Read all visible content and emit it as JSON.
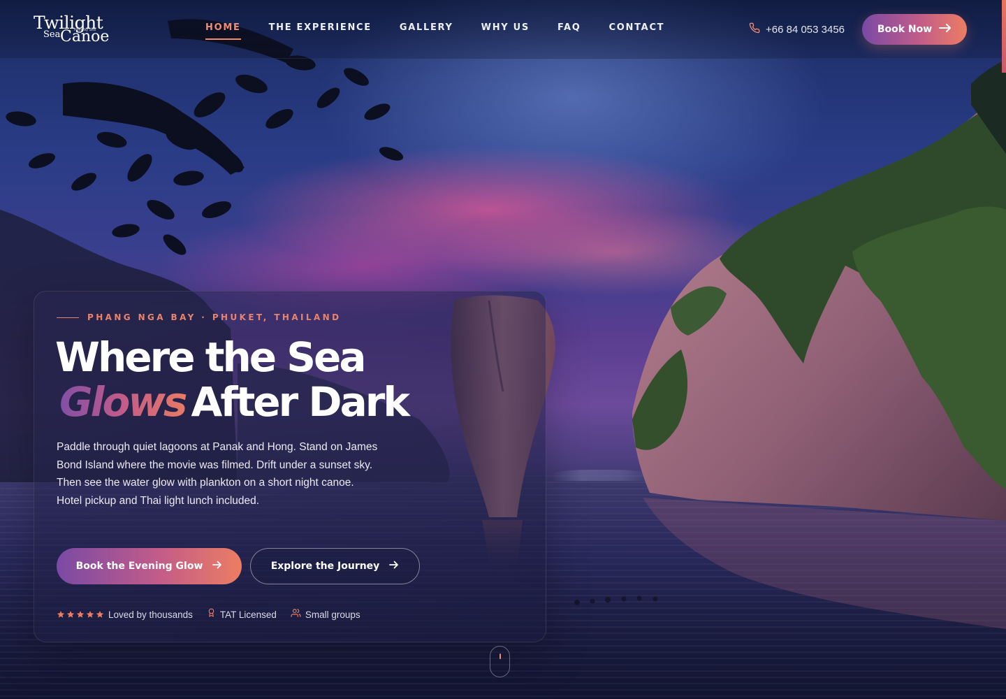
{
  "brand": {
    "line1": "Twilight",
    "line2": "Sea",
    "line3": "Canoe",
    "badge": "Hong by Sea"
  },
  "nav": {
    "items": [
      {
        "label": "HOME",
        "active": true
      },
      {
        "label": "THE EXPERIENCE",
        "active": false
      },
      {
        "label": "GALLERY",
        "active": false
      },
      {
        "label": "WHY US",
        "active": false
      },
      {
        "label": "FAQ",
        "active": false
      },
      {
        "label": "CONTACT",
        "active": false
      }
    ],
    "phone": "+66 84 053 3456",
    "cta_label": "Book Now"
  },
  "hero": {
    "eyebrow": "PHANG NGA BAY · PHUKET, THAILAND",
    "headline_line1": "Where the Sea",
    "headline_highlight": "Glows",
    "headline_line2_rest": "After Dark",
    "description": "Paddle through quiet lagoons at Panak and Hong. Stand on James Bond Island where the movie was filmed. Drift under a sunset sky. Then see the water glow with plankton on a short night canoe. Hotel pickup and Thai light lunch included.",
    "primary_cta": "Book the Evening Glow",
    "secondary_cta": "Explore the Journey",
    "rating_stars": 5,
    "trust": {
      "rating_text": "Loved by thousands",
      "license_text": "TAT Licensed",
      "groups_text": "Small groups"
    }
  },
  "colors": {
    "accent": "#ef8c74",
    "gradient_start": "#7a4aa4",
    "gradient_mid": "#c25c89",
    "gradient_end": "#ec7d62"
  },
  "icons": {
    "phone": "phone-icon",
    "arrow": "arrow-right-icon",
    "star": "star-icon",
    "award": "award-icon",
    "users": "users-icon",
    "mouse": "mouse-scroll-icon"
  }
}
